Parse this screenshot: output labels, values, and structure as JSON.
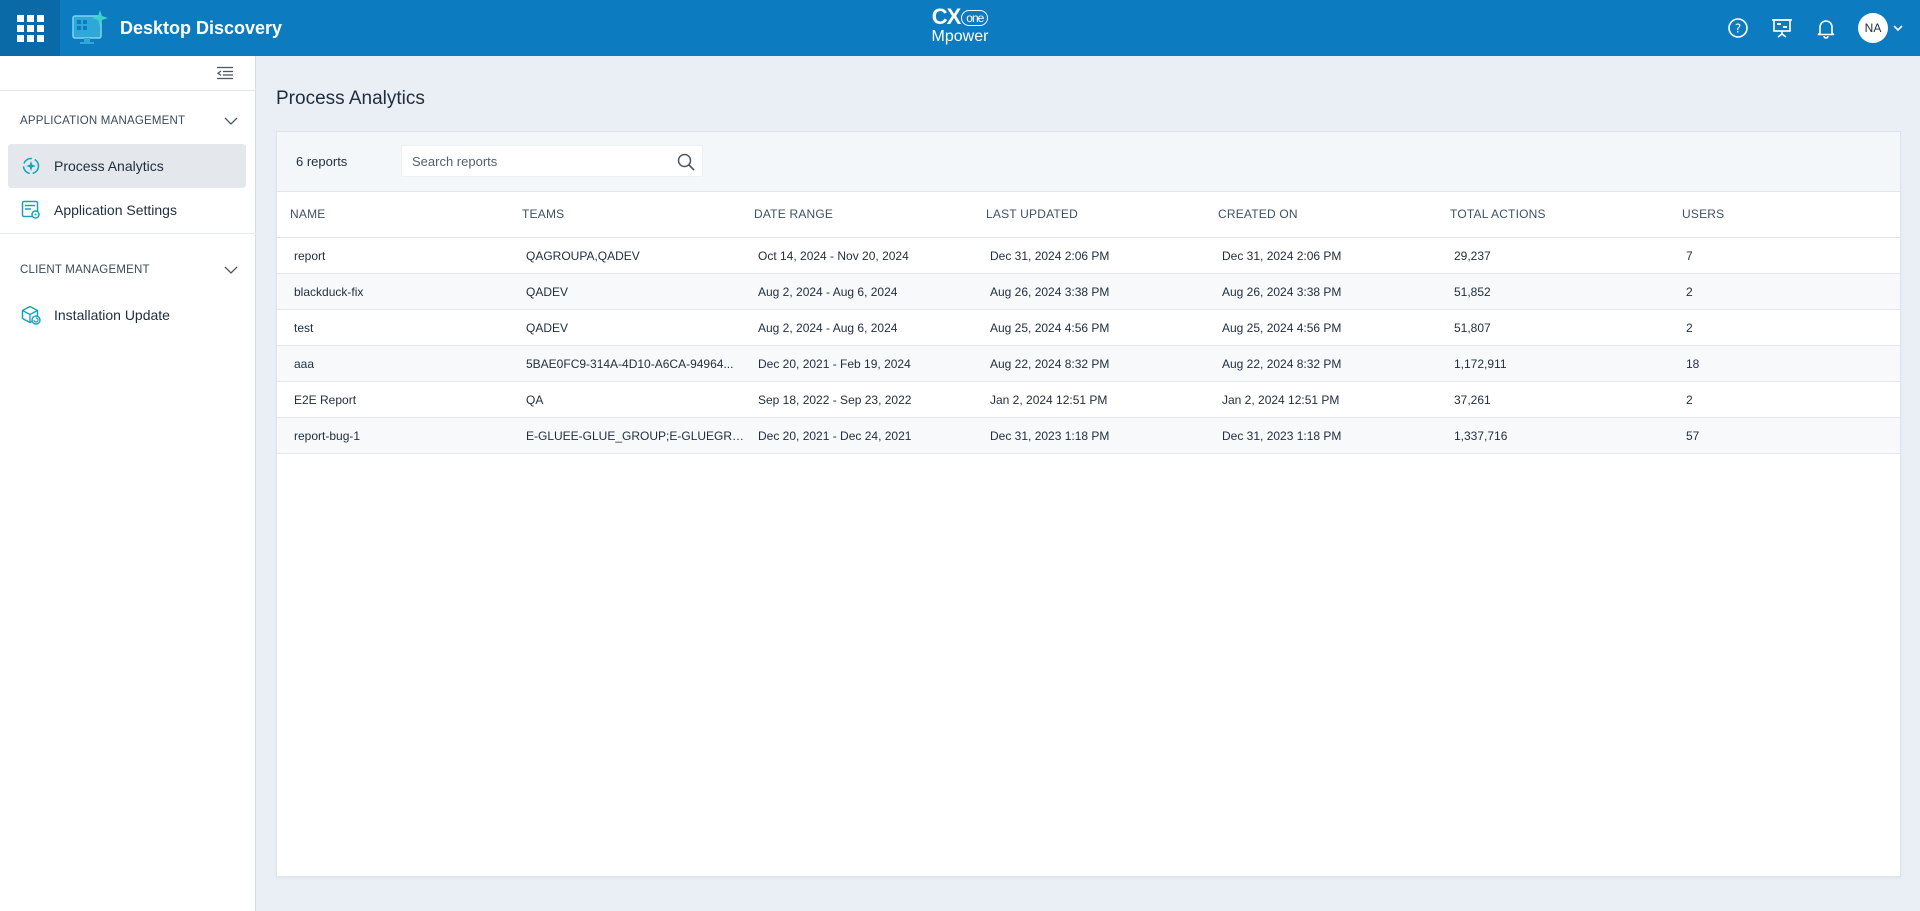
{
  "header": {
    "app_title": "Desktop Discovery",
    "center_logo_line1": "CX",
    "center_logo_badge": "one",
    "center_logo_line2": "Mpower",
    "avatar_initials": "NA",
    "brand_color": "#0c7bc0"
  },
  "sidebar": {
    "sections": [
      {
        "title": "APPLICATION MANAGEMENT"
      },
      {
        "title": "CLIENT MANAGEMENT"
      }
    ],
    "items": [
      {
        "label": "Process Analytics",
        "icon": "process-analytics-icon",
        "active": true
      },
      {
        "label": "Application Settings",
        "icon": "application-settings-icon"
      },
      {
        "label": "Installation Update",
        "icon": "installation-update-icon"
      }
    ]
  },
  "main": {
    "title": "Process Analytics",
    "report_count": "6 reports",
    "search_placeholder": "Search reports",
    "columns": [
      "NAME",
      "TEAMS",
      "DATE RANGE",
      "LAST UPDATED",
      "CREATED ON",
      "TOTAL ACTIONS",
      "USERS"
    ],
    "rows": [
      [
        "report",
        "QAGROUPA,QADEV",
        "Oct 14, 2024 - Nov 20, 2024",
        "Dec 31, 2024 2:06 PM",
        "Dec 31, 2024 2:06 PM",
        "29,237",
        "7"
      ],
      [
        "blackduck-fix",
        "QADEV",
        "Aug 2, 2024 - Aug 6, 2024",
        "Aug 26, 2024 3:38 PM",
        "Aug 26, 2024 3:38 PM",
        "51,852",
        "2"
      ],
      [
        "test",
        "QADEV",
        "Aug 2, 2024 - Aug 6, 2024",
        "Aug 25, 2024 4:56 PM",
        "Aug 25, 2024 4:56 PM",
        "51,807",
        "2"
      ],
      [
        "aaa",
        "5BAE0FC9-314A-4D10-A6CA-94964...",
        "Dec 20, 2021 - Feb 19, 2024",
        "Aug 22, 2024 8:32 PM",
        "Aug 22, 2024 8:32 PM",
        "1,172,911",
        "18"
      ],
      [
        "E2E Report",
        "QA",
        "Sep 18, 2022 - Sep 23, 2022",
        "Jan 2, 2024 12:51 PM",
        "Jan 2, 2024 12:51 PM",
        "37,261",
        "2"
      ],
      [
        "report-bug-1",
        "E-GLUEE-GLUE_GROUP;E-GLUEGRO...",
        "Dec 20, 2021 - Dec 24, 2021",
        "Dec 31, 2023 1:18 PM",
        "Dec 31, 2023 1:18 PM",
        "1,337,716",
        "57"
      ]
    ]
  }
}
